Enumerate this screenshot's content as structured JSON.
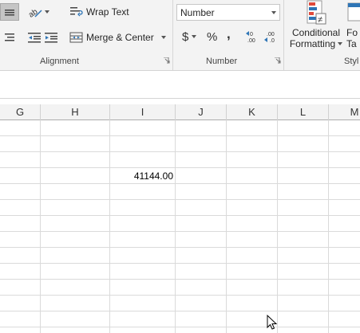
{
  "ribbon": {
    "alignment": {
      "wrap_text_label": "Wrap Text",
      "merge_center_label": "Merge & Center",
      "group_label": "Alignment"
    },
    "number": {
      "format_value": "Number",
      "currency_symbol": "$",
      "percent_symbol": "%",
      "comma_symbol": ",",
      "group_label": "Number"
    },
    "styles": {
      "conditional_formatting_line1": "Conditional",
      "conditional_formatting_line2": "Formatting",
      "format_as_table_line1": "Fo",
      "format_as_table_line2": "Ta",
      "group_label": "Styl"
    }
  },
  "sheet": {
    "columns": [
      "G",
      "H",
      "I",
      "J",
      "K",
      "L",
      "M"
    ],
    "cells": [
      {
        "column": "I",
        "row_index": 3,
        "value": "41144.00"
      }
    ]
  }
}
